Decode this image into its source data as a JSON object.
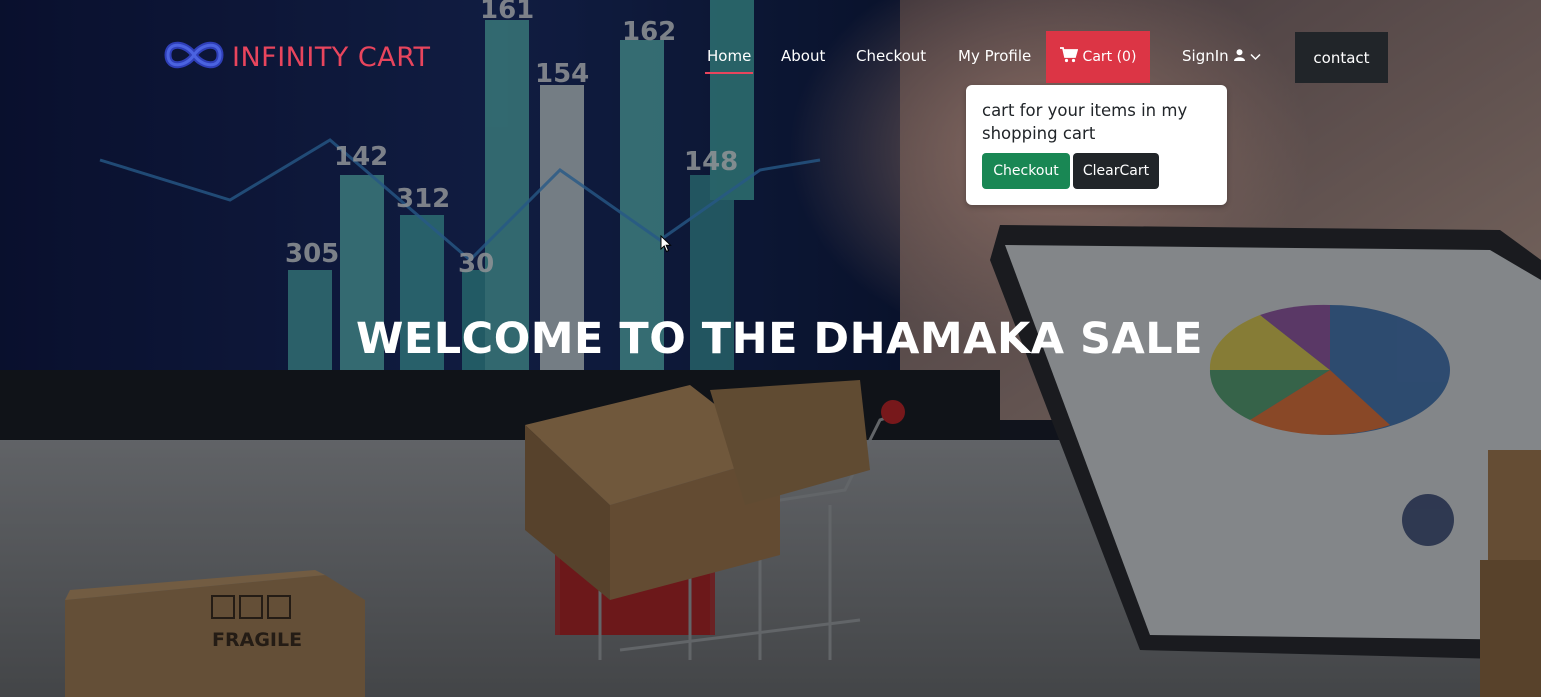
{
  "brand": {
    "name": "INFINITY CART",
    "color": "#e8455d",
    "logo_icon": "infinity-icon"
  },
  "nav": {
    "items": [
      {
        "label": "Home",
        "active": true
      },
      {
        "label": "About"
      },
      {
        "label": "Checkout"
      },
      {
        "label": "My Profile"
      }
    ],
    "cart_label": "Cart (0)",
    "cart_icon": "cart-icon",
    "cart_color": "#dc3545",
    "signin_label": "SignIn",
    "signin_icons": [
      "user-icon",
      "chevron-down-icon"
    ],
    "contact_label": "contact"
  },
  "cart_popover": {
    "text": "cart for your items in my shopping cart",
    "checkout_label": "Checkout",
    "clear_label": "ClearCart",
    "checkout_color": "#198754",
    "clear_color": "#212529"
  },
  "hero": {
    "heading": "WELCOME TO THE DHAMAKA SALE",
    "background_text": {
      "chart_numbers": [
        "161",
        "162",
        "154",
        "142",
        "312",
        "305",
        "148",
        "30"
      ],
      "box_label": "FRAGILE"
    }
  }
}
